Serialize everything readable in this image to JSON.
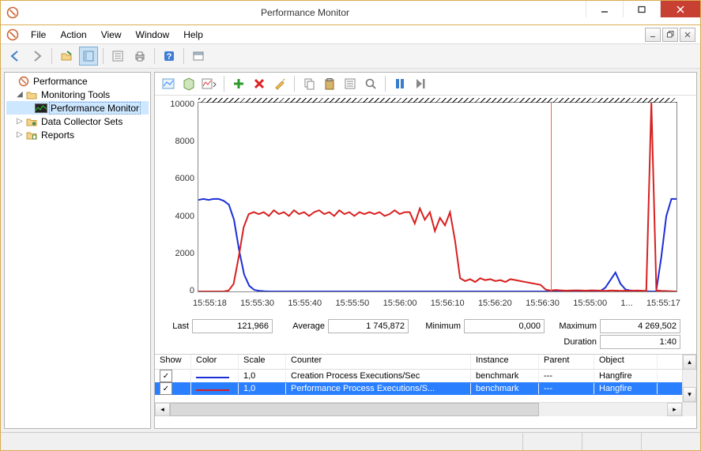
{
  "window": {
    "title": "Performance Monitor"
  },
  "menu": {
    "items": [
      "File",
      "Action",
      "View",
      "Window",
      "Help"
    ]
  },
  "tree": {
    "root": "Performance",
    "items": [
      {
        "label": "Monitoring Tools",
        "expanded": true,
        "children": [
          {
            "label": "Performance Monitor",
            "selected": true
          }
        ]
      },
      {
        "label": "Data Collector Sets",
        "expanded": false
      },
      {
        "label": "Reports",
        "expanded": false
      }
    ]
  },
  "chart_data": {
    "type": "line",
    "ylabel": "",
    "ylim": [
      0,
      10000
    ],
    "y_ticks": [
      "10000",
      "8000",
      "6000",
      "4000",
      "2000",
      "0"
    ],
    "x_ticks": [
      "15:55:18",
      "15:55:30",
      "15:55:40",
      "15:55:50",
      "15:56:00",
      "15:56:10",
      "15:56:20",
      "15:56:30",
      "15:55:00",
      "1...",
      "15:55:17"
    ],
    "marker_x_ratio": 0.737,
    "series": [
      {
        "name": "Creation Process Executions/Sec",
        "color": "#1a2fd8",
        "values": [
          4850,
          4900,
          4850,
          4900,
          4900,
          4800,
          4600,
          3800,
          2200,
          900,
          300,
          80,
          30,
          10,
          0,
          0,
          0,
          0,
          0,
          0,
          0,
          0,
          0,
          0,
          0,
          0,
          0,
          0,
          0,
          0,
          0,
          0,
          0,
          0,
          0,
          0,
          0,
          0,
          0,
          0,
          0,
          0,
          0,
          0,
          0,
          0,
          0,
          0,
          0,
          0,
          0,
          0,
          0,
          0,
          0,
          0,
          0,
          0,
          0,
          0,
          0,
          0,
          0,
          0,
          0,
          0,
          0,
          0,
          0,
          0,
          0,
          0,
          0,
          0,
          0,
          0,
          0,
          0,
          0,
          20,
          200,
          600,
          1000,
          400,
          100,
          50,
          30,
          20,
          10,
          0,
          0,
          1800,
          4000,
          4900,
          4900
        ]
      },
      {
        "name": "Performance Process Executions/Sec",
        "color": "#d81f1f",
        "values": [
          0,
          0,
          0,
          0,
          0,
          0,
          50,
          400,
          1800,
          3400,
          4100,
          4200,
          4100,
          4200,
          4000,
          4300,
          4100,
          4200,
          4000,
          4300,
          4100,
          4200,
          4000,
          4200,
          4300,
          4100,
          4200,
          4000,
          4300,
          4100,
          4200,
          4000,
          4200,
          4100,
          4200,
          4100,
          4200,
          4000,
          4100,
          4300,
          4100,
          4200,
          4200,
          3600,
          4400,
          3800,
          4200,
          3200,
          3900,
          3500,
          4200,
          2700,
          700,
          550,
          650,
          500,
          700,
          600,
          650,
          550,
          600,
          500,
          650,
          600,
          550,
          500,
          450,
          400,
          350,
          100,
          50,
          80,
          60,
          40,
          50,
          60,
          50,
          40,
          60,
          50,
          40,
          30,
          50,
          40,
          30,
          40,
          30,
          50,
          40,
          30,
          10000,
          50,
          30,
          20,
          10,
          0
        ]
      }
    ]
  },
  "stats": {
    "last": {
      "label": "Last",
      "value": "121,966"
    },
    "average": {
      "label": "Average",
      "value": "1 745,872"
    },
    "minimum": {
      "label": "Minimum",
      "value": "0,000"
    },
    "maximum": {
      "label": "Maximum",
      "value": "4 269,502"
    },
    "duration": {
      "label": "Duration",
      "value": "1:40"
    }
  },
  "counter_table": {
    "headers": {
      "show": "Show",
      "color": "Color",
      "scale": "Scale",
      "counter": "Counter",
      "instance": "Instance",
      "parent": "Parent",
      "object": "Object"
    },
    "rows": [
      {
        "checked": true,
        "color": "#1a2fd8",
        "scale": "1,0",
        "counter": "Creation Process Executions/Sec",
        "instance": "benchmark",
        "parent": "---",
        "object": "Hangfire",
        "selected": false
      },
      {
        "checked": true,
        "color": "#d81f1f",
        "scale": "1,0",
        "counter": "Performance Process Executions/S...",
        "instance": "benchmark",
        "parent": "---",
        "object": "Hangfire",
        "selected": true
      }
    ]
  }
}
